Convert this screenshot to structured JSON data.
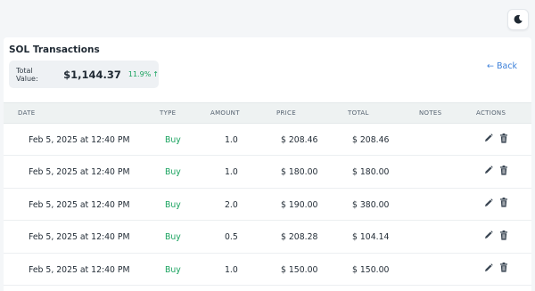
{
  "page": {
    "title": "SOL Transactions",
    "back_label": "← Back",
    "theme_icon": "moon-icon"
  },
  "summary": {
    "total_label": "Total Value:",
    "total_value": "$1,144.37",
    "change_pct": "11.9%",
    "change_arrow": "↑",
    "change_color": "#1aa35f"
  },
  "table": {
    "columns": [
      "DATE",
      "TYPE",
      "AMOUNT",
      "PRICE",
      "TOTAL",
      "NOTES",
      "ACTIONS"
    ],
    "rows": [
      {
        "date": "Feb 5, 2025 at 12:40 PM",
        "type": "Buy",
        "amount": "1.0",
        "price": "$ 208.46",
        "total": "$ 208.46",
        "notes": ""
      },
      {
        "date": "Feb 5, 2025 at 12:40 PM",
        "type": "Buy",
        "amount": "1.0",
        "price": "$ 180.00",
        "total": "$ 180.00",
        "notes": ""
      },
      {
        "date": "Feb 5, 2025 at 12:40 PM",
        "type": "Buy",
        "amount": "2.0",
        "price": "$ 190.00",
        "total": "$ 380.00",
        "notes": ""
      },
      {
        "date": "Feb 5, 2025 at 12:40 PM",
        "type": "Buy",
        "amount": "0.5",
        "price": "$ 208.28",
        "total": "$ 104.14",
        "notes": ""
      },
      {
        "date": "Feb 5, 2025 at 12:40 PM",
        "type": "Buy",
        "amount": "1.0",
        "price": "$ 150.00",
        "total": "$ 150.00",
        "notes": ""
      }
    ],
    "row_icons": [
      "pencil-icon",
      "trash-icon"
    ]
  }
}
